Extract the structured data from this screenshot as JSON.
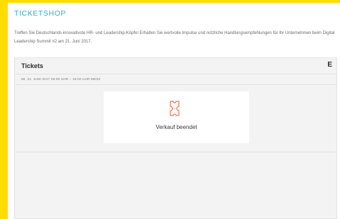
{
  "shop": {
    "title": "TICKETSHOP",
    "intro": "Treffen Sie Deutschlands innovativste HR- und Leadership-Köpfe! Erhalten Sie wertvolle Impulse und nützliche Handlungsempfehlungen für Ihr Unternehmen beim Digital Leadership Summit #2 am 21. Juni 2017."
  },
  "widget": {
    "title": "Tickets",
    "language_label": "E",
    "event_date": "MI, 21. JUNI 2017 09:00 UHR – 18:00 UHR MESZ",
    "status": "Verkauf beendet",
    "status_icon": "ticket-icon"
  },
  "colors": {
    "brand_yellow": "#ffdd00",
    "accent_teal": "#2bb0cc",
    "icon_orange": "#f0724f"
  }
}
